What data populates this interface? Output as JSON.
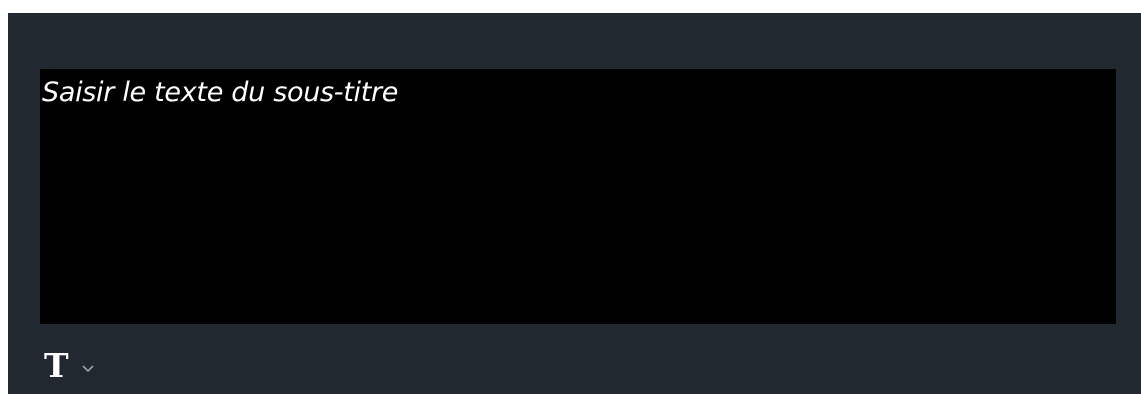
{
  "subtitle_editor": {
    "placeholder": "Saisir le texte du sous-titre"
  },
  "toolbar": {
    "font_icon_glyph": "T",
    "font_icon_name": "text-format-icon",
    "dropdown_icon_name": "chevron-down-icon"
  },
  "colors": {
    "panel_background": "#222830",
    "editor_background": "#000000",
    "text": "#ffffff"
  }
}
